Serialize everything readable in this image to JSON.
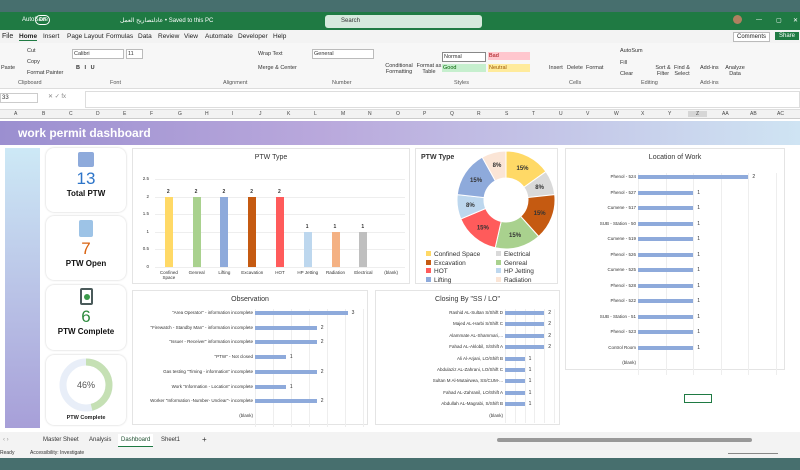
{
  "titlebar": {
    "autosave": "AutoSave",
    "toggle": "Off",
    "filename": "عادلتصاريح العمل • Saved to this PC",
    "search": "Search"
  },
  "tabs": [
    "File",
    "Home",
    "Insert",
    "Page Layout",
    "Formulas",
    "Data",
    "Review",
    "View",
    "Automate",
    "Developer",
    "Help"
  ],
  "ribbon": {
    "comments": "Comments",
    "share": "Share",
    "paste": "Paste",
    "cut": "Cut",
    "copy": "Copy",
    "format_painter": "Format Painter",
    "font": "Calibri",
    "size": "11",
    "wrap": "Wrap Text",
    "merge": "Merge & Center",
    "number_format": "General",
    "cond": "Conditional Formatting",
    "fmt_table": "Format as Table",
    "styles": [
      "Normal",
      "Bad",
      "Good",
      "Neutral"
    ],
    "insert": "Insert",
    "delete": "Delete",
    "format": "Format",
    "autosum": "AutoSum",
    "fill": "Fill",
    "clear": "Clear",
    "sort": "Sort & Filter",
    "find": "Find & Select",
    "addins": "Add-ins",
    "analyze": "Analyze Data",
    "groups": [
      "Clipboard",
      "Font",
      "Alignment",
      "Number",
      "Styles",
      "Cells",
      "Editing",
      "Add-ins"
    ]
  },
  "namebox": "33",
  "columns": [
    "A",
    "B",
    "C",
    "D",
    "E",
    "F",
    "G",
    "H",
    "I",
    "J",
    "K",
    "L",
    "M",
    "N",
    "O",
    "P",
    "Q",
    "R",
    "S",
    "T",
    "U",
    "V",
    "W",
    "X",
    "Y",
    "Z",
    "AA",
    "AB",
    "AC"
  ],
  "dashboard": {
    "title": "work permit dashboard",
    "kpis": [
      {
        "value": "13",
        "label": "Total PTW",
        "color": "#2e75c9"
      },
      {
        "value": "7",
        "label": "PTW Open",
        "color": "#d9620f"
      },
      {
        "value": "6",
        "label": "PTW Complete",
        "color": "#2e8b3e"
      }
    ],
    "gauge": {
      "value": "46%",
      "percent": 46,
      "label": "PTW Complete"
    }
  },
  "chart_data": [
    {
      "type": "bar",
      "title": "PTW Type",
      "categories": [
        "Confined Space",
        "Genreal",
        "Lifting",
        "Excavation",
        "HOT",
        "HP Jetting",
        "Radiation",
        "Electrical",
        "(blank)"
      ],
      "values": [
        2,
        2,
        2,
        2,
        2,
        1,
        1,
        1,
        null
      ],
      "colors": [
        "#ffd966",
        "#a9d18e",
        "#8eaadb",
        "#c55a11",
        "#ff5b5b",
        "#bdd7ee",
        "#f4b183",
        "#bfbfbf",
        "#ffffff"
      ],
      "ylim": [
        0,
        2.5
      ],
      "yticks": [
        "0",
        "0.5",
        "1",
        "1.5",
        "2",
        "2.5"
      ]
    },
    {
      "type": "pie",
      "title": "PTW Type",
      "categories": [
        "Confined Space",
        "Electrical",
        "Excavation",
        "Genreal",
        "HOT",
        "HP Jetting",
        "Lifting",
        "Radiation"
      ],
      "order": [
        "Confined Space",
        "Electrical",
        "Excavation",
        "Genreal",
        "HOT",
        "HP Jetting",
        "Lifting",
        "Radiation"
      ],
      "values": [
        15,
        8,
        15,
        15,
        15,
        8,
        15,
        8
      ],
      "labels": [
        "15%",
        "8%",
        "15%",
        "15%",
        "15%",
        "8%",
        "15%",
        "8%"
      ],
      "colors": [
        "#ffd966",
        "#d9d9d9",
        "#c55a11",
        "#a9d18e",
        "#ff5b5b",
        "#bdd7ee",
        "#8eaadb",
        "#fbe5d6"
      ],
      "legend": "bottom"
    },
    {
      "type": "bar",
      "orientation": "horizontal",
      "title": "Location of Work",
      "categories": [
        "Phenol - 524",
        "Phenol - 527",
        "Cumene - 517",
        "SUB - Station - 50",
        "Cumene - 519",
        "Phenol - 526",
        "Cumene - 525",
        "Phenol - 528",
        "Phenol - 522",
        "SUB - Station - 51",
        "Phenol - 523",
        "Control Room",
        "(blank)"
      ],
      "values": [
        2,
        1,
        1,
        1,
        1,
        1,
        1,
        1,
        1,
        1,
        1,
        1,
        null
      ],
      "xlim": [
        0,
        2.5
      ]
    },
    {
      "type": "bar",
      "orientation": "horizontal",
      "title": "Observation",
      "categories": [
        "\"Area Operator\" - information incomplete",
        "\"Firewatch - Standby Man\" - information incomplete",
        "\"Issuer - Receiver\" information incomplete",
        "\"PTW\" - Not closed",
        "Gas testing \"Timing - information\" incomplete",
        "Work \"Information - Location\" incomplete",
        "Worker \"Information -Number- Unclear\"- incomplete",
        "(blank)"
      ],
      "values": [
        3,
        2,
        2,
        1,
        2,
        1,
        2,
        null
      ],
      "xlim": [
        0,
        3.5
      ]
    },
    {
      "type": "bar",
      "orientation": "horizontal",
      "title": "Closing By \"SS / LO\"",
      "categories": [
        "Rashid AL-Sultan S/Shift D",
        "Majed AL-Harbi S/Shift C",
        "Alammate AL-Shammari,...",
        "Fahad AL-Aklobil, S/Shift A",
        "Ali Al-Arjani, LO/Shift B",
        "Abdulaziz AL-Zahrani, LO/Shift C",
        "Sultan M Al-Mutairwea, SS/CUM-...",
        "Fahad AL-Zahranil, LO/Shift A",
        "Abdullah AL-Magrabi, S/Shift B",
        "(blank)"
      ],
      "values": [
        2,
        2,
        2,
        2,
        1,
        1,
        1,
        1,
        1,
        null
      ],
      "xlim": [
        0,
        2.5
      ]
    }
  ],
  "sheets": [
    "Master Sheet",
    "Analysis",
    "Dashboard",
    "Sheet1"
  ],
  "active_sheet": "Dashboard",
  "status": {
    "ready": "Ready",
    "accessibility": "Accessibility: Investigate"
  }
}
